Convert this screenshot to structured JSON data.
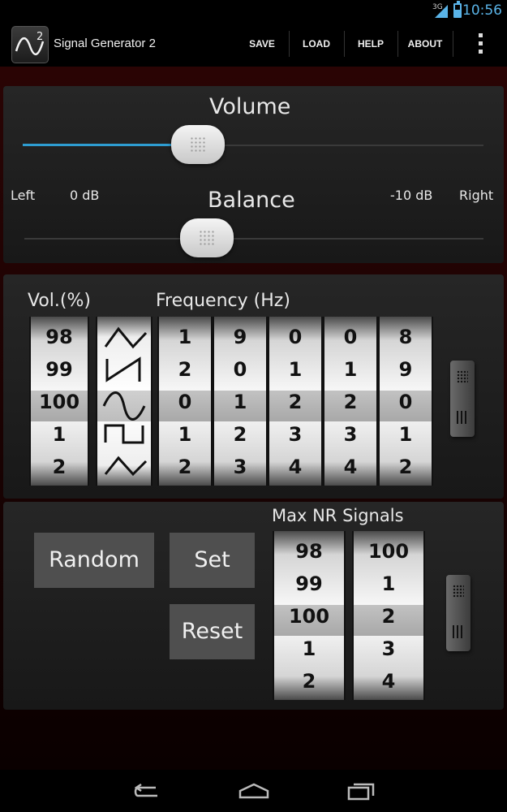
{
  "status_bar": {
    "network": "3G",
    "time": "10:56"
  },
  "action_bar": {
    "title": "Signal Generator 2",
    "actions": [
      "SAVE",
      "LOAD",
      "HELP",
      "ABOUT"
    ],
    "overflow_icon": "overflow-menu-icon"
  },
  "volume": {
    "label": "Volume",
    "level": 0.38
  },
  "balance": {
    "label": "Balance",
    "left_label": "Left",
    "left_db": "0 dB",
    "right_db": "-10 dB",
    "right_label": "Right",
    "level": 0.4
  },
  "signal": {
    "vol_header": "Vol.(%)",
    "freq_header": "Frequency (Hz)",
    "vol_wheel": [
      "98",
      "99",
      "100",
      "1",
      "2"
    ],
    "waveforms": [
      "triangle",
      "sawtooth",
      "sine",
      "square",
      "triangle"
    ],
    "digit_wheels": [
      [
        "1",
        "2",
        "0",
        "1",
        "2"
      ],
      [
        "9",
        "0",
        "1",
        "2",
        "3"
      ],
      [
        "0",
        "1",
        "2",
        "3",
        "4"
      ],
      [
        "0",
        "1",
        "2",
        "3",
        "4"
      ],
      [
        "8",
        "9",
        "0",
        "1",
        "2"
      ]
    ]
  },
  "controls": {
    "random_label": "Random",
    "set_label": "Set",
    "reset_label": "Reset",
    "max_nr_header": "Max NR Signals",
    "wheel_a": [
      "98",
      "99",
      "100",
      "1",
      "2"
    ],
    "wheel_b": [
      "100",
      "1",
      "2",
      "3",
      "4"
    ]
  },
  "nav_bar": {
    "icons": [
      "back-icon",
      "home-icon",
      "recent-apps-icon"
    ]
  },
  "colors": {
    "accent": "#2e9dd1",
    "status_blue": "#5ab4e8",
    "button": "#4f4f4f"
  }
}
